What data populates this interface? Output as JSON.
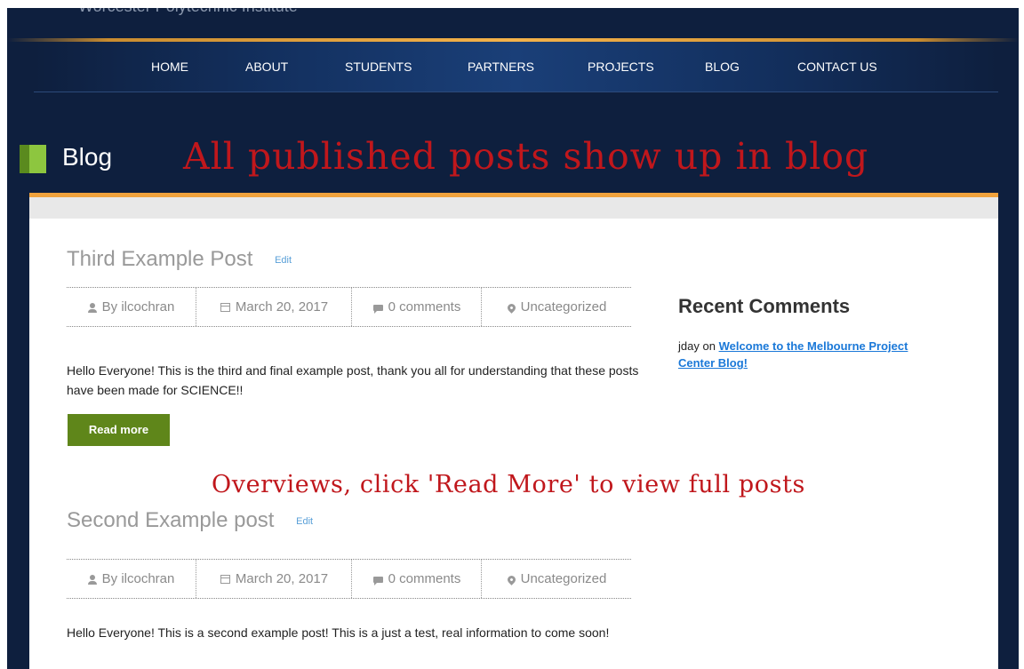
{
  "site": {
    "org_name": "Worcester Polytechnic Institute"
  },
  "nav": {
    "items": [
      "HOME",
      "ABOUT",
      "STUDENTS",
      "PARTNERS",
      "PROJECTS",
      "BLOG",
      "CONTACT US"
    ]
  },
  "page": {
    "title": "Blog"
  },
  "annotations": {
    "header_note": "All published posts show up in blog",
    "overview_note": "Overviews, click 'Read More' to view full posts"
  },
  "posts": [
    {
      "title": "Third Example Post",
      "edit_label": "Edit",
      "author": "By ilcochran",
      "date": "March 20, 2017",
      "comments": "0 comments",
      "category": "Uncategorized",
      "excerpt": "Hello Everyone! This is the third and final example post, thank you all for understanding that these posts have been made for SCIENCE!!",
      "read_more_label": "Read more"
    },
    {
      "title": "Second Example post",
      "edit_label": "Edit",
      "author": "By ilcochran",
      "date": "March 20, 2017",
      "comments": "0 comments",
      "category": "Uncategorized",
      "excerpt": "Hello Everyone! This is a second example post! This is a just a test, real information to come soon!"
    }
  ],
  "sidebar": {
    "recent_comments": {
      "title": "Recent Comments",
      "items": [
        {
          "author": "jday",
          "connector": "on",
          "post_link": "Welcome to the Melbourne Project Center Blog!"
        }
      ]
    }
  },
  "colors": {
    "header_bg": "#0e1f3e",
    "nav_accent": "#1a3f78",
    "gold_rule": "#f4b24a",
    "orange_rule": "#f0a23c",
    "button_green": "#5f861a",
    "annotation_red": "#c0171c",
    "link_blue": "#1a78d8"
  }
}
